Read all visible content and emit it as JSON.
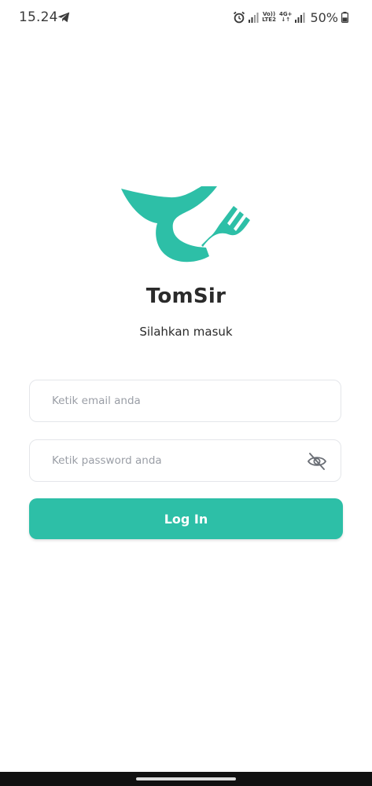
{
  "status_bar": {
    "time": "15.24",
    "volte_label_top": "Vo))",
    "volte_label_bottom": "LTE2",
    "network_label_top": "4G+",
    "network_label_bottom": "↓↑",
    "battery_percent": "50%",
    "icons": [
      "telegram-icon",
      "alarm-icon",
      "signal-icon",
      "battery-icon"
    ]
  },
  "app": {
    "title": "TomSir",
    "subtitle": "Silahkan masuk",
    "brand_color": "#2dbfa7"
  },
  "form": {
    "email_placeholder": "Ketik email anda",
    "email_value": "",
    "password_placeholder": "Ketik password anda",
    "password_value": "",
    "password_toggle_icon": "eye-off-icon",
    "login_label": "Log In"
  }
}
